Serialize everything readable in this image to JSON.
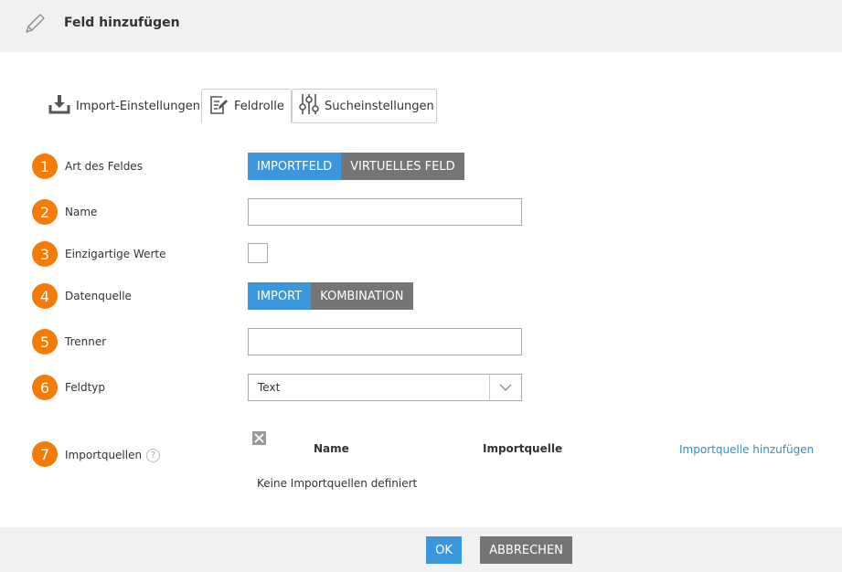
{
  "header": {
    "title": "Feld hinzufügen",
    "icon": "pencil-icon"
  },
  "tabs": [
    {
      "label": "Import-Einstellungen",
      "icon": "download-tray-icon"
    },
    {
      "label": "Feldrolle",
      "icon": "edit-document-icon"
    },
    {
      "label": "Sucheinstellungen",
      "icon": "sliders-icon"
    }
  ],
  "fields": {
    "type": {
      "number": "1",
      "label": "Art des Feldes",
      "options": [
        "IMPORTFELD",
        "VIRTUELLES FELD"
      ],
      "selected": "IMPORTFELD"
    },
    "name": {
      "number": "2",
      "label": "Name",
      "value": ""
    },
    "unique": {
      "number": "3",
      "label": "Einzigartige Werte",
      "checked": false
    },
    "source": {
      "number": "4",
      "label": "Datenquelle",
      "options": [
        "IMPORT",
        "KOMBINATION"
      ],
      "selected": "IMPORT"
    },
    "separator": {
      "number": "5",
      "label": "Trenner",
      "value": ""
    },
    "fieldtype": {
      "number": "6",
      "label": "Feldtyp",
      "value": "Text"
    },
    "importsources": {
      "number": "7",
      "label": "Importquellen",
      "help": "?",
      "columns": [
        "Name",
        "Importquelle"
      ],
      "add_link": "Importquelle hinzufügen",
      "empty_text": "Keine Importquellen definiert"
    }
  },
  "footer": {
    "ok_label": "OK",
    "cancel_label": "ABBRECHEN"
  },
  "colors": {
    "accent": "#3b97dd",
    "inactive": "#757575",
    "badge": "#f47b06",
    "link": "#3a8bc8"
  }
}
